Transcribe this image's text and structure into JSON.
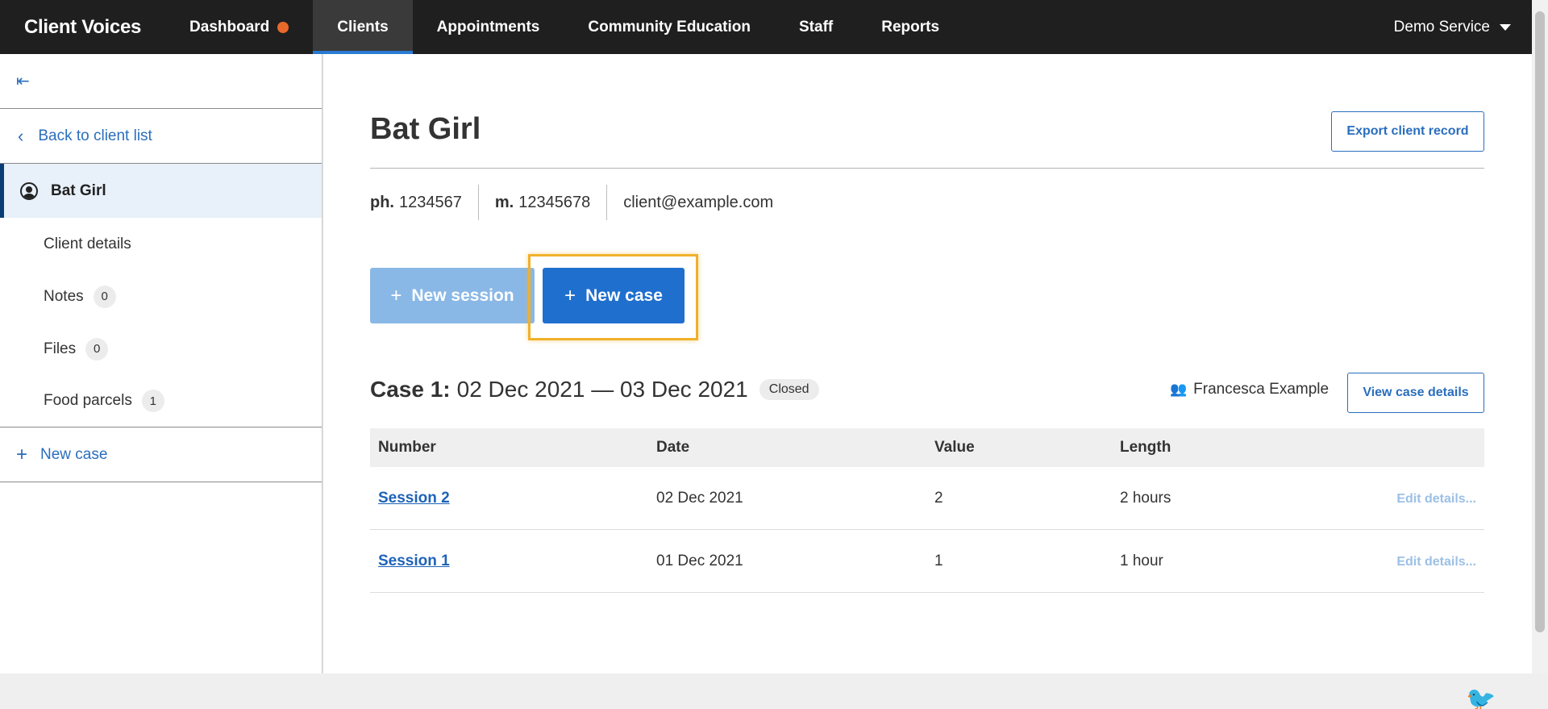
{
  "app": {
    "brand": "Client Voices",
    "service": "Demo Service"
  },
  "nav": {
    "dashboard": "Dashboard",
    "clients": "Clients",
    "appointments": "Appointments",
    "community_education": "Community Education",
    "staff": "Staff",
    "reports": "Reports"
  },
  "sidebar": {
    "collapse_icon": "⇤",
    "back_label": "Back to client list",
    "client_name": "Bat Girl",
    "items": [
      {
        "label": "Client details"
      },
      {
        "label": "Notes",
        "count": "0"
      },
      {
        "label": "Files",
        "count": "0"
      },
      {
        "label": "Food parcels",
        "count": "1"
      }
    ],
    "new_case_label": "New case"
  },
  "client": {
    "name": "Bat Girl",
    "export_label": "Export client record",
    "phone_label": "ph.",
    "phone": "1234567",
    "mobile_label": "m.",
    "mobile": "12345678",
    "email": "client@example.com"
  },
  "actions": {
    "new_session": "New session",
    "new_case": "New case"
  },
  "case": {
    "label": "Case 1:",
    "dates": "02 Dec 2021 — 03 Dec 2021",
    "status": "Closed",
    "worker": "Francesca Example",
    "view_label": "View case details",
    "columns": [
      "Number",
      "Date",
      "Value",
      "Length"
    ],
    "rows": [
      {
        "number": "Session 2",
        "date": "02 Dec 2021",
        "value": "2",
        "length": "2 hours",
        "edit": "Edit details..."
      },
      {
        "number": "Session 1",
        "date": "01 Dec 2021",
        "value": "1",
        "length": "1 hour",
        "edit": "Edit details..."
      }
    ]
  },
  "colors": {
    "accent": "#2a6ebd",
    "nav_bg": "#1f1f1f",
    "highlight": "#f0b02a",
    "dot": "#e8692b"
  }
}
